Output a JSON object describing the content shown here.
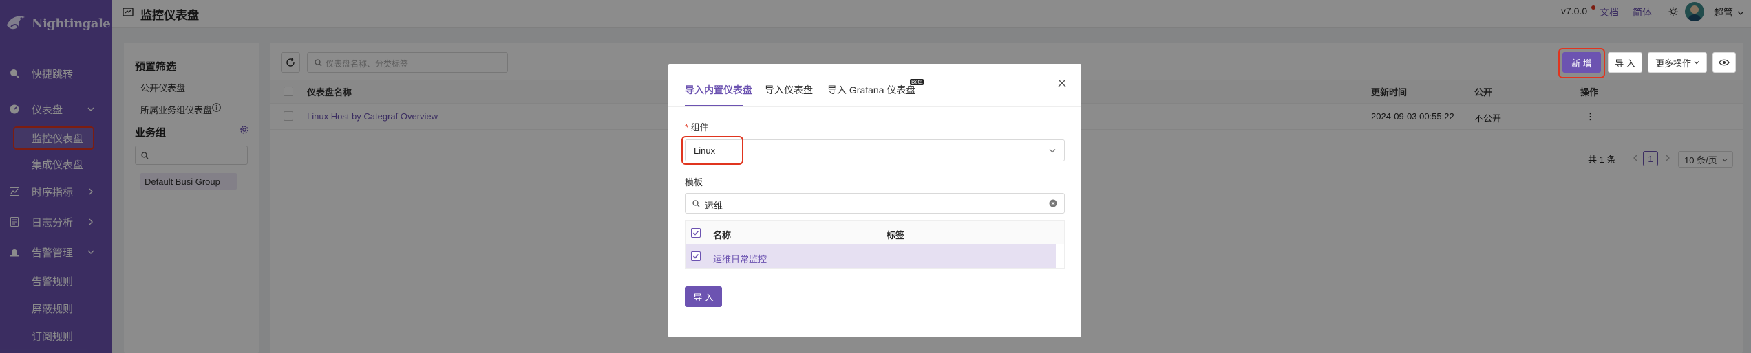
{
  "sidebar": {
    "brand": "Nightingale",
    "items": [
      {
        "label": "快捷跳转"
      },
      {
        "label": "仪表盘"
      },
      {
        "label": "监控仪表盘"
      },
      {
        "label": "集成仪表盘"
      },
      {
        "label": "时序指标"
      },
      {
        "label": "日志分析"
      },
      {
        "label": "告警管理"
      },
      {
        "label": "告警规则"
      },
      {
        "label": "屏蔽规则"
      },
      {
        "label": "订阅规则"
      }
    ]
  },
  "header": {
    "title": "监控仪表盘",
    "version": "v7.0.0",
    "docs": "文档",
    "lang": "简体",
    "user": "超管"
  },
  "filters": {
    "title": "预置筛选",
    "public": "公开仪表盘",
    "mine": "所属业务组仪表盘",
    "group_title": "业务组",
    "group_item": "Default Busi Group"
  },
  "toolbar": {
    "search_placeholder": "仪表盘名称、分类标签",
    "new": "新 增",
    "import": "导 入",
    "more": "更多操作"
  },
  "table": {
    "headers": {
      "name": "仪表盘名称",
      "updated": "更新时间",
      "public": "公开",
      "ops": "操作"
    },
    "rows": [
      {
        "name": "Linux Host by Categraf Overview",
        "updated": "2024-09-03 00:55:22",
        "public": "不公开",
        "ops": "⋮"
      }
    ]
  },
  "pagination": {
    "total": "共 1 条",
    "page": "1",
    "size": "10 条/页"
  },
  "modal": {
    "tabs": [
      {
        "label": "导入内置仪表盘",
        "active": true
      },
      {
        "label": "导入仪表盘"
      },
      {
        "label": "导入 Grafana 仪表盘",
        "badge": "Beta"
      }
    ],
    "component_label": "组件",
    "component_value": "Linux",
    "template_label": "模板",
    "template_search": "运维",
    "cols": {
      "name": "名称",
      "tags": "标签"
    },
    "rows": [
      {
        "name": "运维日常监控",
        "tags": ""
      }
    ],
    "submit": "导 入"
  },
  "colors": {
    "primary": "#6c53b1",
    "highlight": "#e0351f",
    "link": "#6c53b1"
  }
}
